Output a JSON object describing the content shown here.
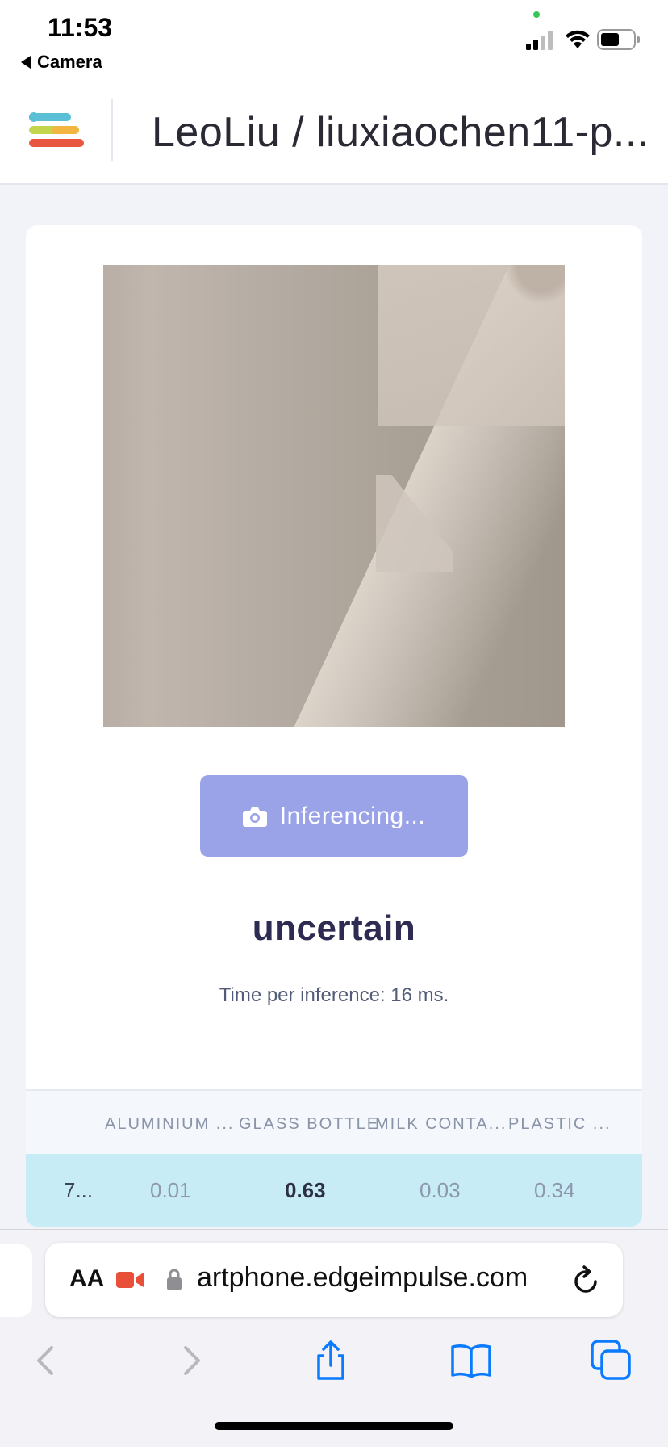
{
  "status_bar": {
    "time": "11:53",
    "back_app": "Camera",
    "icons": [
      "signal-icon",
      "wifi-icon",
      "battery-icon"
    ]
  },
  "header": {
    "project_title": "LeoLiu / liuxiaochen11-p..."
  },
  "main": {
    "button_label": "Inferencing...",
    "result": "uncertain",
    "time_per_inference": "Time per inference: 16 ms.",
    "table": {
      "columns": [
        "",
        "ALUMINIUM ...",
        "GLASS BOTTLE",
        "MILK CONTA...",
        "PLASTIC ..."
      ],
      "rows": [
        [
          "7...",
          "0.01",
          "0.63",
          "0.03",
          "0.34"
        ]
      ]
    }
  },
  "browser": {
    "aa_label": "AA",
    "url": "artphone.edgeimpulse.com"
  },
  "colors": {
    "accent": "#9aa2e8",
    "result_text": "#2e2b52",
    "row_highlight": "#c8ecf5",
    "safari_blue": "#0a7aff"
  }
}
